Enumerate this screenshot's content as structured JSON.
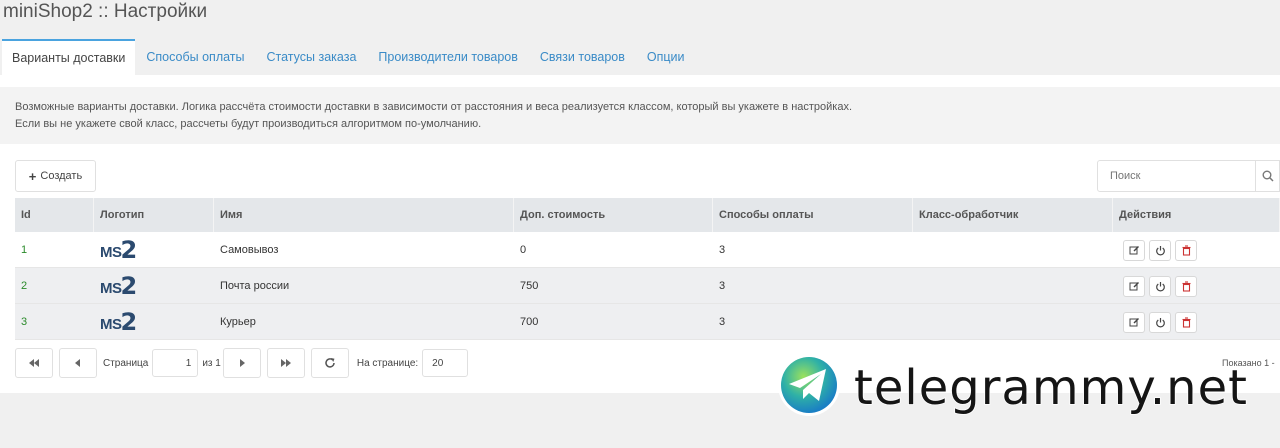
{
  "title": "miniShop2 :: Настройки",
  "tabs": [
    "Варианты доставки",
    "Способы оплаты",
    "Статусы заказа",
    "Производители товаров",
    "Связи товаров",
    "Опции"
  ],
  "description": {
    "line1": "Возможные варианты доставки. Логика рассчёта стоимости доставки в зависимости от расстояния и веса реализуется классом, который вы укажете в настройках.",
    "line2": "Если вы не укажете свой класс, рассчеты будут производиться алгоритмом по-умолчанию."
  },
  "toolbar": {
    "create_label": "Создать",
    "search_placeholder": "Поиск"
  },
  "grid": {
    "columns": [
      "Id",
      "Логотип",
      "Имя",
      "Доп. стоимость",
      "Способы оплаты",
      "Класс-обработчик",
      "Действия"
    ],
    "rows": [
      {
        "id": "1",
        "logo": "MS2",
        "name": "Самовывоз",
        "price": "0",
        "payments": "3",
        "class": ""
      },
      {
        "id": "2",
        "logo": "MS2",
        "name": "Почта россии",
        "price": "750",
        "payments": "3",
        "class": ""
      },
      {
        "id": "3",
        "logo": "MS2",
        "name": "Курьер",
        "price": "700",
        "payments": "3",
        "class": ""
      }
    ]
  },
  "pager": {
    "page_label": "Страница",
    "page_value": "1",
    "of_label": "из 1",
    "per_page_label": "На странице:",
    "per_page_value": "20",
    "shown_text": "Показано 1 -"
  },
  "watermark": {
    "text": "telegrammy.net"
  },
  "icons": [
    "plus-icon",
    "search-icon",
    "edit-icon",
    "power-icon",
    "trash-icon",
    "first-page-icon",
    "prev-page-icon",
    "next-page-icon",
    "last-page-icon",
    "refresh-icon",
    "telegram-logo-icon"
  ],
  "colors": {
    "link": "#3a8bc7",
    "active_tab_border": "#4aa3df",
    "delete": "#cc3333",
    "logo": "#2b4a6f"
  }
}
